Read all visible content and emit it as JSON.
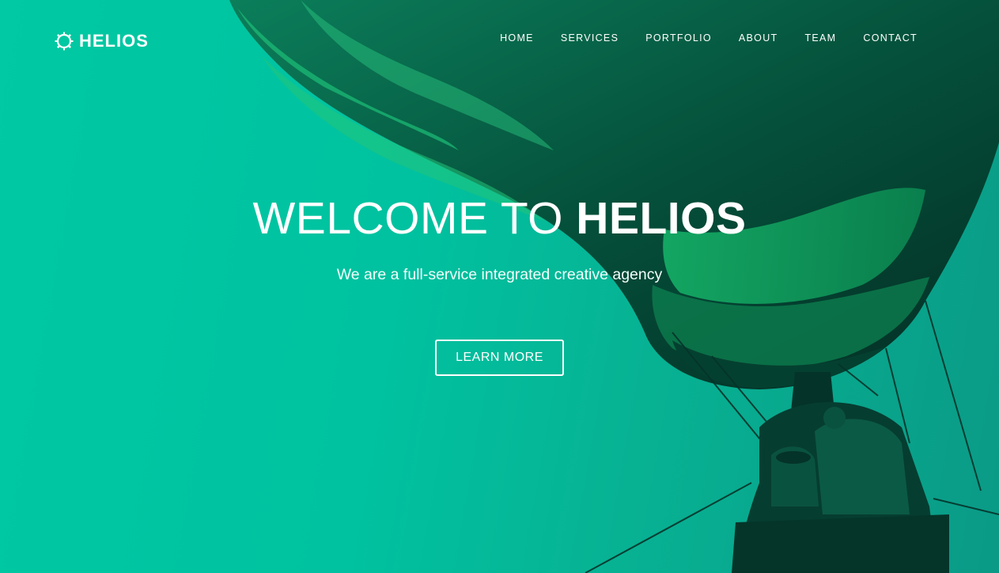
{
  "brand": {
    "name": "HELIOS",
    "icon": "sun-gear-icon"
  },
  "nav": {
    "items": [
      "HOME",
      "SERVICES",
      "PORTFOLIO",
      "ABOUT",
      "TEAM",
      "CONTACT"
    ]
  },
  "hero": {
    "title_prefix": "WELCOME TO ",
    "title_emphasis": "HELIOS",
    "subtitle": "We are a full-service integrated creative agency",
    "cta_label": "LEARN MORE"
  },
  "colors": {
    "primary": "#00c2a0",
    "dark_overlay": "#04332a",
    "text": "#ffffff"
  }
}
